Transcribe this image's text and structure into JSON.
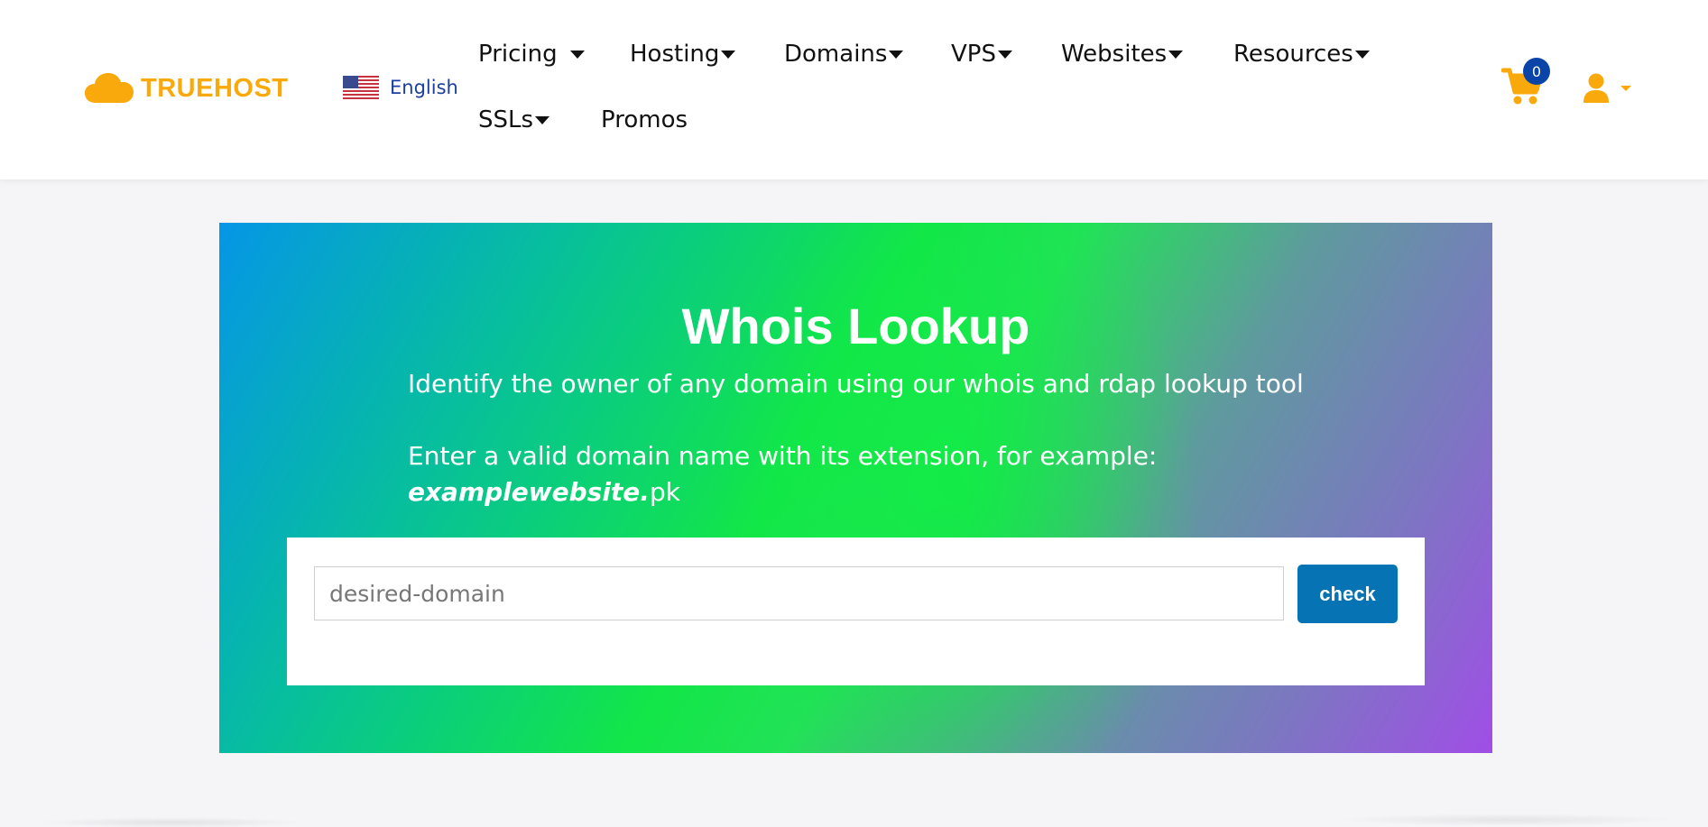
{
  "brand": {
    "name": "TRUEHOST",
    "color": "#f9a90b"
  },
  "language": {
    "label": "English",
    "flag_icon": "us-flag-icon"
  },
  "nav": {
    "items": [
      {
        "label": "Pricing",
        "has_dropdown": true
      },
      {
        "label": "Hosting",
        "has_dropdown": true
      },
      {
        "label": "Domains",
        "has_dropdown": true
      },
      {
        "label": "VPS",
        "has_dropdown": true
      },
      {
        "label": "Websites",
        "has_dropdown": true
      },
      {
        "label": "Resources",
        "has_dropdown": true
      },
      {
        "label": "SSLs",
        "has_dropdown": true
      },
      {
        "label": "Promos",
        "has_dropdown": false
      }
    ]
  },
  "cart": {
    "count": "0",
    "icon": "cart-icon",
    "badge_color": "#0b44a8"
  },
  "user": {
    "icon": "user-icon"
  },
  "hero": {
    "title": "Whois Lookup",
    "subtitle": "Identify the owner of any domain using our whois and rdap lookup tool",
    "instruction": "Enter a valid domain name with its extension, for example:",
    "example_bold": "examplewebsite.",
    "example_ext": "pk"
  },
  "search": {
    "placeholder": "desired-domain",
    "value": "",
    "button_label": "check",
    "button_color": "#0673b4"
  }
}
